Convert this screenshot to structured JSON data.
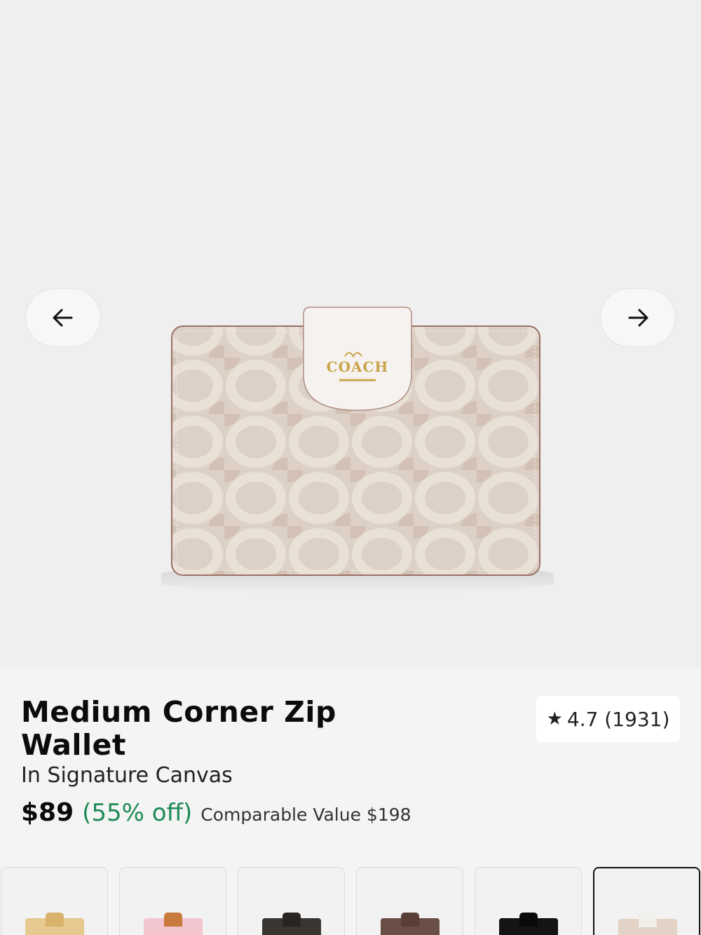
{
  "gallery": {
    "prev_label": "Previous image",
    "next_label": "Next image",
    "image_alt": "Medium Corner Zip Wallet in Signature Canvas"
  },
  "product": {
    "title": "Medium Corner Zip Wallet",
    "subtitle": "In Signature Canvas",
    "price": "$89",
    "discount": "(55% off)",
    "comparable": "Comparable Value $198",
    "rating": {
      "star_icon": "star-icon",
      "text": "4.7 (1931)"
    }
  },
  "colors": {
    "accent_green": "#1e8a55",
    "background": "#f4f4f4"
  },
  "swatches": [
    {
      "name": "tan",
      "body": "#e6c98e",
      "tab": "#d8b26a",
      "selected": false
    },
    {
      "name": "pink",
      "body": "#f3c6cf",
      "tab": "#c77a3c",
      "selected": false
    },
    {
      "name": "brown-black",
      "body": "#3a3530",
      "tab": "#2a2520",
      "selected": false
    },
    {
      "name": "brown",
      "body": "#6a4f46",
      "tab": "#5a3f36",
      "selected": false
    },
    {
      "name": "black",
      "body": "#141414",
      "tab": "#0a0a0a",
      "selected": false
    },
    {
      "name": "sand-chalk",
      "body": "#e2d3c6",
      "tab": "#f1efe9",
      "selected": true
    }
  ]
}
